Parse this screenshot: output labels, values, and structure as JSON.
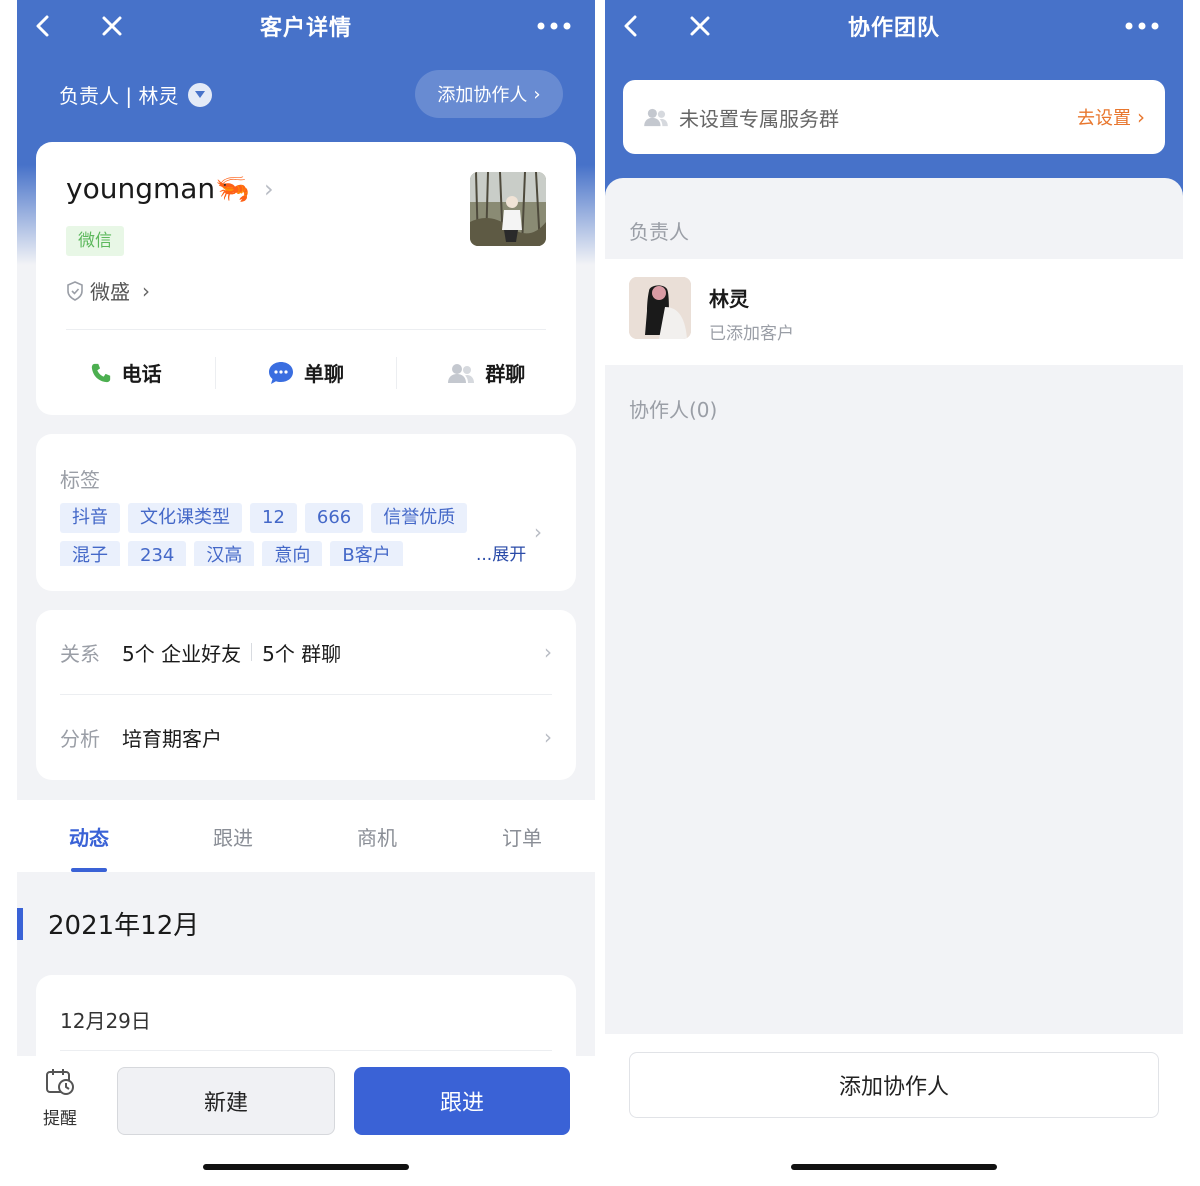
{
  "left": {
    "header": {
      "title": "客户详情"
    },
    "owner": {
      "label": "负责人 | 林灵",
      "add_collab": "添加协作人"
    },
    "customer": {
      "name": "youngman🦐",
      "source_tag": "微信",
      "company": "微盛",
      "actions": [
        {
          "label": "电话",
          "icon": "phone-icon"
        },
        {
          "label": "单聊",
          "icon": "chat-icon"
        },
        {
          "label": "群聊",
          "icon": "group-chat-icon"
        }
      ]
    },
    "tags": {
      "title": "标签",
      "row1": [
        "抖音",
        "文化课类型",
        "12",
        "666",
        "信誉优质"
      ],
      "row2": [
        "混子",
        "234",
        "汉高",
        "意向",
        "B客户"
      ],
      "expand": "...展开"
    },
    "relation": {
      "label": "关系",
      "friends": "5个 企业好友",
      "groups": "5个 群聊"
    },
    "analysis": {
      "label": "分析",
      "value": "培育期客户"
    },
    "tabs": [
      "动态",
      "跟进",
      "商机",
      "订单"
    ],
    "active_tab": 0,
    "timeline": {
      "month": "2021年12月",
      "day": "12月29日"
    },
    "bottom": {
      "remind": "提醒",
      "new": "新建",
      "follow": "跟进"
    }
  },
  "right": {
    "header": {
      "title": "协作团队"
    },
    "service_group": {
      "text": "未设置专属服务群",
      "action": "去设置"
    },
    "owner_section": {
      "title": "负责人",
      "name": "林灵",
      "status": "已添加客户"
    },
    "collab_section": {
      "title": "协作人(0)"
    },
    "add_button": "添加协作人"
  },
  "colors": {
    "primary": "#4772c9",
    "button": "#3a62d6",
    "accent_orange": "#e8772e",
    "tag_green": "#5cb85c"
  }
}
